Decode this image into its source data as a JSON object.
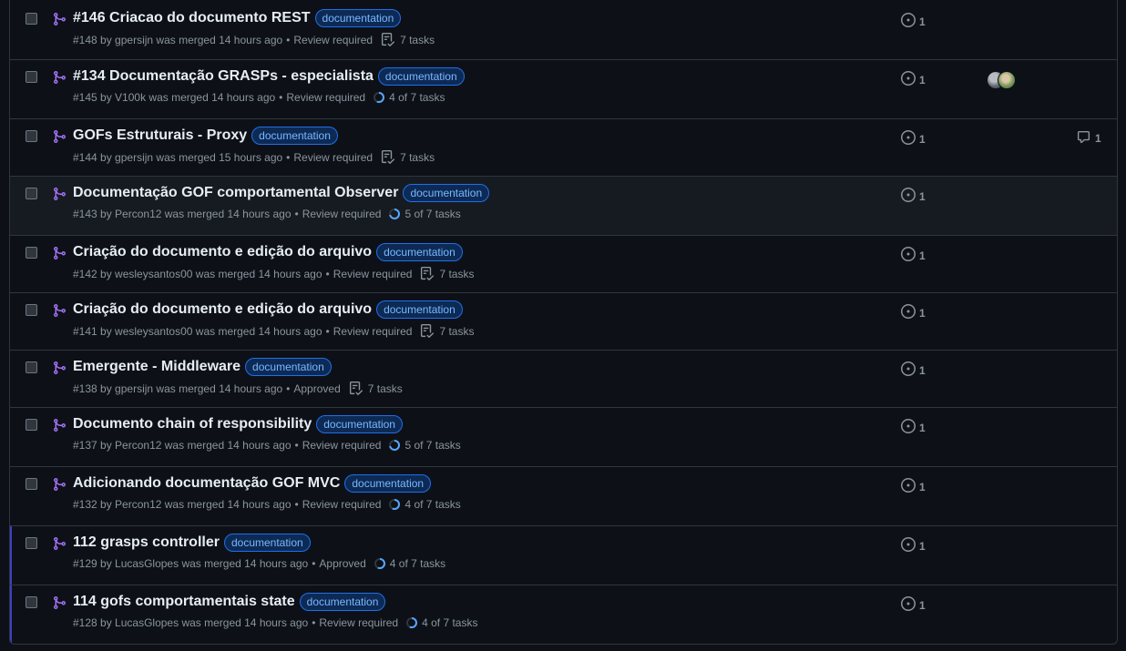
{
  "colors": {
    "background": "#0d1117",
    "border": "#30363d",
    "merged_purple": "#a371f7",
    "label_text": "#79b8ff",
    "muted": "#8b949e"
  },
  "pull_requests": [
    {
      "title": "#146 Criacao do documento REST",
      "label": "documentation",
      "number": "#148",
      "author": "gpersijn",
      "merged": "was merged 14 hours ago",
      "review": "Review required",
      "tasks": "7 tasks",
      "tasks_icon": "checklist-icon",
      "linked_issues": "1"
    },
    {
      "title": "#134 Documentação GRASPs - especialista",
      "label": "documentation",
      "number": "#145",
      "author": "V100k",
      "merged": "was merged 14 hours ago",
      "review": "Review required",
      "tasks": "4 of 7 tasks",
      "tasks_icon": "progress-icon",
      "progress": 0.57,
      "linked_issues": "1",
      "has_avatars": true
    },
    {
      "title": "GOFs Estruturais - Proxy",
      "label": "documentation",
      "number": "#144",
      "author": "gpersijn",
      "merged": "was merged 15 hours ago",
      "review": "Review required",
      "tasks": "7 tasks",
      "tasks_icon": "checklist-icon",
      "linked_issues": "1",
      "comments": "1"
    },
    {
      "title": "Documentação GOF comportamental Observer",
      "label": "documentation",
      "number": "#143",
      "author": "Percon12",
      "merged": "was merged 14 hours ago",
      "review": "Review required",
      "tasks": "5 of 7 tasks",
      "tasks_icon": "progress-icon",
      "progress": 0.71,
      "linked_issues": "1",
      "highlighted": true
    },
    {
      "title": "Criação do documento e edição do arquivo",
      "label": "documentation",
      "number": "#142",
      "author": "wesleysantos00",
      "merged": "was merged 14 hours ago",
      "review": "Review required",
      "tasks": "7 tasks",
      "tasks_icon": "checklist-icon",
      "linked_issues": "1"
    },
    {
      "title": "Criação do documento e edição do arquivo",
      "label": "documentation",
      "number": "#141",
      "author": "wesleysantos00",
      "merged": "was merged 14 hours ago",
      "review": "Review required",
      "tasks": "7 tasks",
      "tasks_icon": "checklist-icon",
      "linked_issues": "1"
    },
    {
      "title": "Emergente - Middleware",
      "label": "documentation",
      "number": "#138",
      "author": "gpersijn",
      "merged": "was merged 14 hours ago",
      "review": "Approved",
      "tasks": "7 tasks",
      "tasks_icon": "checklist-icon",
      "linked_issues": "1"
    },
    {
      "title": "Documento chain of responsibility",
      "label": "documentation",
      "number": "#137",
      "author": "Percon12",
      "merged": "was merged 14 hours ago",
      "review": "Review required",
      "tasks": "5 of 7 tasks",
      "tasks_icon": "progress-icon",
      "progress": 0.71,
      "linked_issues": "1"
    },
    {
      "title": "Adicionando documentação GOF MVC",
      "label": "documentation",
      "number": "#132",
      "author": "Percon12",
      "merged": "was merged 14 hours ago",
      "review": "Review required",
      "tasks": "4 of 7 tasks",
      "tasks_icon": "progress-icon",
      "progress": 0.57,
      "linked_issues": "1"
    },
    {
      "title": "112 grasps controller",
      "label": "documentation",
      "number": "#129",
      "author": "LucasGlopes",
      "merged": "was merged 14 hours ago",
      "review": "Approved",
      "tasks": "4 of 7 tasks",
      "tasks_icon": "progress-icon",
      "progress": 0.57,
      "linked_issues": "1",
      "accent": true
    },
    {
      "title": "114 gofs comportamentais state",
      "label": "documentation",
      "number": "#128",
      "author": "LucasGlopes",
      "merged": "was merged 14 hours ago",
      "review": "Review required",
      "tasks": "4 of 7 tasks",
      "tasks_icon": "progress-icon",
      "progress": 0.57,
      "linked_issues": "1",
      "accent": true
    }
  ]
}
